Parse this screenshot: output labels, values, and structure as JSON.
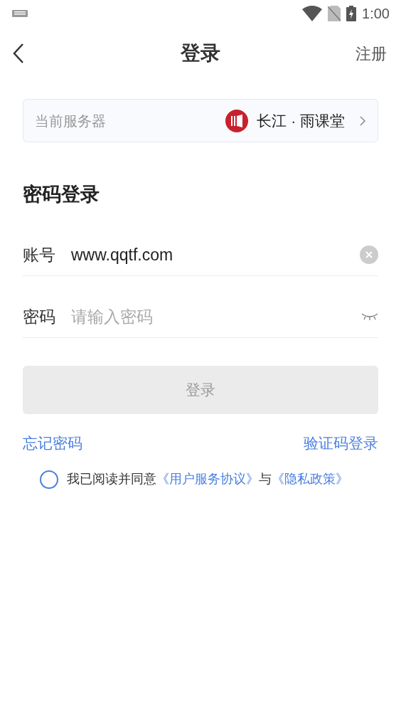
{
  "status_bar": {
    "time": "1:00"
  },
  "nav": {
    "title": "登录",
    "action": "注册"
  },
  "server": {
    "label": "当前服务器",
    "name": "长江 · 雨课堂"
  },
  "section_title": "密码登录",
  "fields": [
    {
      "kind": "account",
      "label": "账号",
      "value": "www.qqtf.com"
    },
    {
      "kind": "password",
      "label": "密码",
      "placeholder": "请输入密码"
    }
  ],
  "login_button": {
    "label": "登录",
    "disabled": true
  },
  "links": {
    "forgot": "忘记密码",
    "code_login": "验证码登录"
  },
  "agreement": {
    "checked": false,
    "text_before": "我已阅读并同意",
    "terms": "《用户服务协议》",
    "joiner": "与",
    "privacy": "《隐私政策》"
  }
}
